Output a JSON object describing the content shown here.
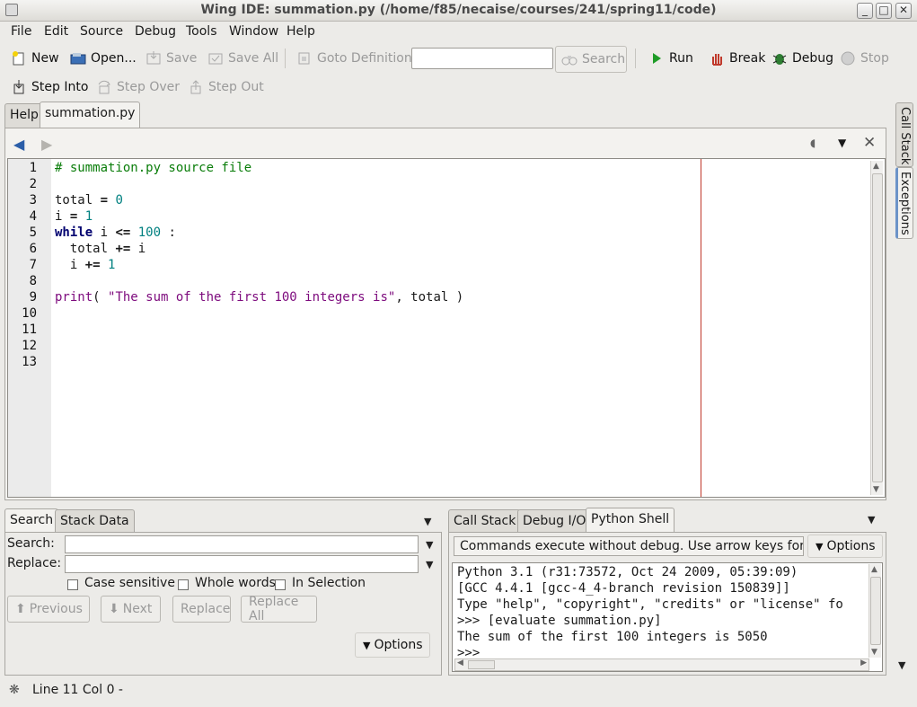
{
  "window": {
    "title": "Wing IDE: summation.py (/home/f85/necaise/courses/241/spring11/code)",
    "minimize": "_",
    "maximize": "□",
    "close": "✕"
  },
  "menu": {
    "file": "File",
    "edit": "Edit",
    "source": "Source",
    "debug": "Debug",
    "tools": "Tools",
    "window": "Window",
    "help": "Help"
  },
  "toolbar": {
    "new": "New",
    "open": "Open...",
    "save": "Save",
    "save_all": "Save All",
    "goto_definition": "Goto Definition",
    "search": "Search",
    "run": "Run",
    "break": "Break",
    "debug": "Debug",
    "stop": "Stop",
    "step_into": "Step Into",
    "step_over": "Step Over",
    "step_out": "Step Out"
  },
  "editor_tabs": {
    "help": "Help",
    "file": "summation.py"
  },
  "editor": {
    "line_numbers": [
      "1",
      "2",
      "3",
      "4",
      "5",
      "6",
      "7",
      "8",
      "9",
      "10",
      "11",
      "12",
      "13"
    ],
    "lines": {
      "l1": "# summation.py source file",
      "l3a": "total ",
      "l3b": "=",
      "l3c": " ",
      "l3d": "0",
      "l4a": "i ",
      "l4b": "=",
      "l4c": " ",
      "l4d": "1",
      "l5a": "while",
      "l5b": " i ",
      "l5c": "<=",
      "l5d": " ",
      "l5e": "100",
      "l5f": " :",
      "l6a": "  total ",
      "l6b": "+=",
      "l6c": " i",
      "l7a": "  i ",
      "l7b": "+=",
      "l7c": " ",
      "l7d": "1",
      "l9a": "print",
      "l9b": "( ",
      "l9c": "\"The sum of the first 100 integers is\"",
      "l9d": ", total )"
    }
  },
  "side_tabs": {
    "call_stack": "Call Stack",
    "exceptions": "Exceptions"
  },
  "search_panel": {
    "tabs": {
      "search": "Search",
      "stack_data": "Stack Data"
    },
    "search_label": "Search:",
    "replace_label": "Replace:",
    "search_value": "",
    "replace_value": "",
    "case_sensitive": "Case sensitive",
    "whole_words": "Whole words",
    "in_selection": "In Selection",
    "previous": "Previous",
    "next": "Next",
    "replace": "Replace",
    "replace_all": "Replace All",
    "options": "Options"
  },
  "shell_panel": {
    "tabs": {
      "call_stack": "Call Stack",
      "debug_io": "Debug I/O",
      "python_shell": "Python Shell"
    },
    "message": "Commands execute without debug.  Use arrow keys for h",
    "options": "Options",
    "output": [
      "Python 3.1 (r31:73572, Oct 24 2009, 05:39:09)",
      "[GCC 4.4.1 [gcc-4_4-branch revision 150839]]",
      "Type \"help\", \"copyright\", \"credits\" or \"license\" fo",
      ">>> [evaluate summation.py]",
      "The sum of the first 100 integers is 5050",
      ">>> "
    ]
  },
  "status": {
    "position": "Line 11 Col 0 -"
  }
}
